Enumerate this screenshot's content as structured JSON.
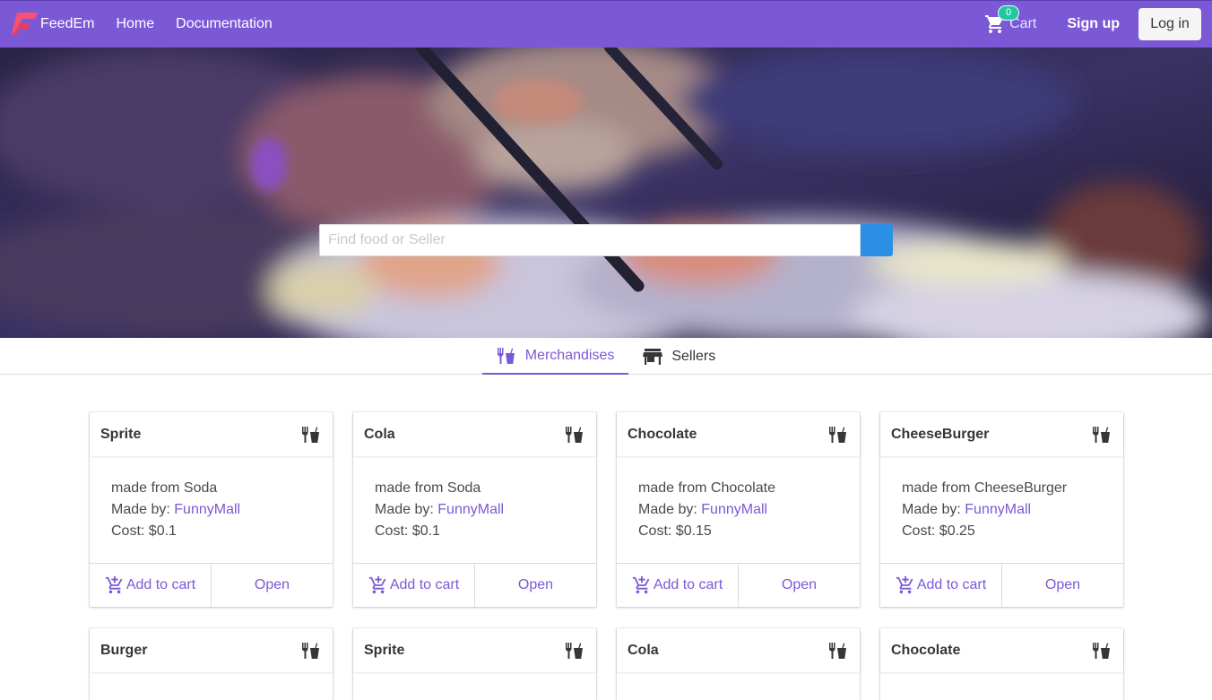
{
  "navbar": {
    "brand": "FeedEm",
    "links": [
      "Home",
      "Documentation"
    ],
    "cart_count": "0",
    "cart_label": "Cart",
    "signup": "Sign up",
    "login": "Log in"
  },
  "search": {
    "placeholder": "Find food or Seller"
  },
  "tabs": [
    {
      "label": "Merchandises",
      "icon": "utensils-icon",
      "active": true
    },
    {
      "label": "Sellers",
      "icon": "store-icon",
      "active": false
    }
  ],
  "cards": [
    {
      "title": "Sprite",
      "description": "made from Soda",
      "made_by_label": "Made by:",
      "seller": "FunnyMall",
      "cost": "Cost: $0.1",
      "add_label": "Add to cart",
      "open_label": "Open"
    },
    {
      "title": "Cola",
      "description": "made from Soda",
      "made_by_label": "Made by:",
      "seller": "FunnyMall",
      "cost": "Cost: $0.1",
      "add_label": "Add to cart",
      "open_label": "Open"
    },
    {
      "title": "Chocolate",
      "description": "made from Chocolate",
      "made_by_label": "Made by:",
      "seller": "FunnyMall",
      "cost": "Cost: $0.15",
      "add_label": "Add to cart",
      "open_label": "Open"
    },
    {
      "title": "CheeseBurger",
      "description": "made from CheeseBurger",
      "made_by_label": "Made by:",
      "seller": "FunnyMall",
      "cost": "Cost: $0.25",
      "add_label": "Add to cart",
      "open_label": "Open"
    },
    {
      "title": "Burger"
    },
    {
      "title": "Sprite"
    },
    {
      "title": "Cola"
    },
    {
      "title": "Chocolate"
    }
  ],
  "colors": {
    "primary": "#7b59d6",
    "search_button": "#2c8fe6",
    "badge": "#1fc8a0"
  }
}
